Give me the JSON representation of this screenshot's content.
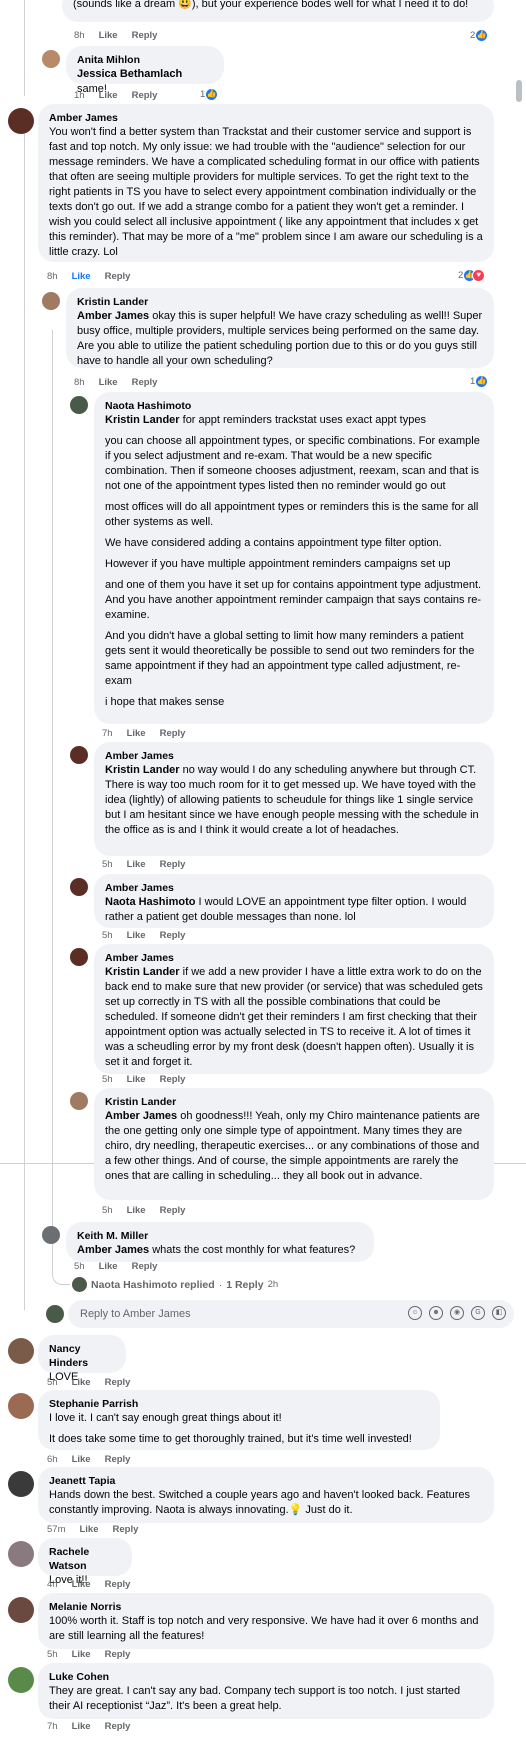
{
  "top_fragment": {
    "text": "(sounds like a dream 😃), but your experience bodes well for what I need it to do!",
    "time": "8h",
    "like": "Like",
    "reply": "Reply",
    "reactions": "2"
  },
  "comments": [
    {
      "id": "anita",
      "author": "Anita Mihlon",
      "mention": "Jessica Bethamlach",
      "text": " same!",
      "time": "1h",
      "like": "Like",
      "reply": "Reply",
      "reactions": "1",
      "avatar_color": "#b88a6a"
    },
    {
      "id": "amber1",
      "author": "Amber James",
      "text": "You won't find a better system than Trackstat and their customer service and support is fast and top notch. My only issue: we had trouble with the \"audience\" selection for our message reminders. We have a complicated scheduling format in our office with patients that often are seeing multiple providers for multiple services. To get the right text to the right patients in TS you have to select every appointment combination individually or the texts don't go out. If we add a strange combo for a patient they won't get a reminder. I wish you could select all inclusive appointment ( like any appointment that includes x get this reminder). That may be more of a \"me\" problem since I am aware our scheduling is a little crazy. Lol",
      "time": "8h",
      "like": "Like",
      "reply": "Reply",
      "reactions": "2",
      "avatar_color": "#5a2e25"
    },
    {
      "id": "kristin1",
      "author": "Kristin Lander",
      "mention": "Amber James",
      "text": " okay this is super helpful! We have crazy scheduling as well!! Super busy office, multiple providers, multiple services being performed on the same day. Are you able to utilize the patient scheduling portion due to this or do you guys still have to handle all your own scheduling?",
      "time": "8h",
      "like": "Like",
      "reply": "Reply",
      "reactions": "1",
      "avatar_color": "#a07a62"
    },
    {
      "id": "naota1",
      "author": "Naota Hashimoto",
      "mention": "Kristin Lander",
      "text": " for appt reminders trackstat uses exact appt types",
      "paragraphs": [
        "you can choose all appointment types, or specific combinations. For example if you select adjustment and re-exam. That would be a new specific combination. Then if someone chooses adjustment, reexam, scan and that is not one of the appointment types listed then no reminder would go out",
        "most offices will do all appointment types or reminders this is the same for all other systems as well.",
        "We have considered adding a contains appointment type filter option.",
        "However if you have multiple appointment reminders campaigns set up",
        "and one of them you have it set up for contains appointment type adjustment. And you have another appointment reminder campaign that says contains re-examine.",
        "And you didn't have a global setting to limit how many reminders a patient gets sent it would theoretically be possible to send out two reminders for the same appointment if they had an appointment type called adjustment, re-exam",
        "i hope that makes sense"
      ],
      "time": "7h",
      "like": "Like",
      "reply": "Reply",
      "avatar_color": "#4a5a48"
    },
    {
      "id": "amber2",
      "author": "Amber James",
      "mention": "Kristin Lander",
      "text": " no way would I do any scheduling anywhere but through CT. There is way too much room for it to get messed up. We have toyed with the idea (lightly) of allowing patients to scheudule for things like 1 single service but I am hesitant since we have enough people messing with the schedule in the office as is and I think it would create a lot of headaches.",
      "time": "5h",
      "like": "Like",
      "reply": "Reply",
      "avatar_color": "#5a2e25"
    },
    {
      "id": "amber3",
      "author": "Amber James",
      "mention": "Naota Hashimoto",
      "text": " I would LOVE an appointment type filter option. I would rather a patient get double messages than none. lol",
      "time": "5h",
      "like": "Like",
      "reply": "Reply",
      "avatar_color": "#5a2e25"
    },
    {
      "id": "amber4",
      "author": "Amber James",
      "mention": "Kristin Lander",
      "text": " if we add a new provider I have a little extra work to do on the back end to make sure that new provider (or service) that was scheduled gets set up correctly in TS with all the possible combinations that could be scheduled. If someone didn't get their reminders I am first checking that their appointment option was actually selected in TS to receive it. A lot of times it was a scheudling error by my front desk (doesn't happen often). Usually it is set it and forget it.",
      "time": "5h",
      "like": "Like",
      "reply": "Reply",
      "avatar_color": "#5a2e25"
    },
    {
      "id": "kristin2",
      "author": "Kristin Lander",
      "mention": "Amber James",
      "text": " oh goodness!!! Yeah, only my Chiro maintenance patients are the one getting only one simple type of appointment. Many times they are chiro, dry needling, therapeutic exercises... or any combinations of those and a few other things. And of course, the simple appointments are rarely the ones that are calling in scheduling... they all book out in advance.",
      "time": "5h",
      "like": "Like",
      "reply": "Reply",
      "avatar_color": "#a07a62"
    },
    {
      "id": "keith",
      "author": "Keith M. Miller",
      "mention": "Amber James",
      "text": " whats the cost monthly for what features?",
      "time": "5h",
      "like": "Like",
      "reply": "Reply",
      "avatar_color": "#6b6f74"
    }
  ],
  "replied_row": {
    "name": "Naota Hashimoto replied",
    "sep": "·",
    "count": "1 Reply",
    "time": "2h"
  },
  "reply_box": {
    "placeholder": "Reply to Amber James"
  },
  "top_level": [
    {
      "author": "Nancy Hinders",
      "text": "LOVE",
      "time": "5h",
      "like": "Like",
      "reply": "Reply",
      "avatar_color": "#7a5a48"
    },
    {
      "author": "Stephanie Parrish",
      "text": "I love it. I can't say enough great things about it!",
      "text2": "It does take some time to get thoroughly trained, but it's time well invested!",
      "time": "6h",
      "like": "Like",
      "reply": "Reply",
      "avatar_color": "#9a6a52"
    },
    {
      "author": "Jeanett Tapia",
      "text": "Hands down the best. Switched a couple years ago and haven't looked back. Features constantly improving. Naota is always innovating.💡 Just do it.",
      "time": "57m",
      "like": "Like",
      "reply": "Reply",
      "avatar_color": "#3a3a3a"
    },
    {
      "author": "Rachele Watson",
      "text": "Love it!!",
      "time": "4h",
      "like": "Like",
      "reply": "Reply",
      "avatar_color": "#8a7a80"
    },
    {
      "author": "Melanie Norris",
      "text": "100% worth it. Staff is top notch and very responsive. We have had it over 6 months and are still learning all the features!",
      "time": "5h",
      "like": "Like",
      "reply": "Reply",
      "avatar_color": "#6a4a40"
    },
    {
      "author": "Luke Cohen",
      "text": "They are great. I can't say any bad. Company tech support is too notch. I just started their AI receptionist “Jaz”. It's been a great help.",
      "time": "7h",
      "like": "Like",
      "reply": "Reply",
      "avatar_color": "#5a8a4a"
    }
  ],
  "colors": {
    "bubble": "#f0f2f5",
    "meta": "#65676b",
    "like_blue": "#1877f2",
    "love_red": "#f33e58"
  }
}
